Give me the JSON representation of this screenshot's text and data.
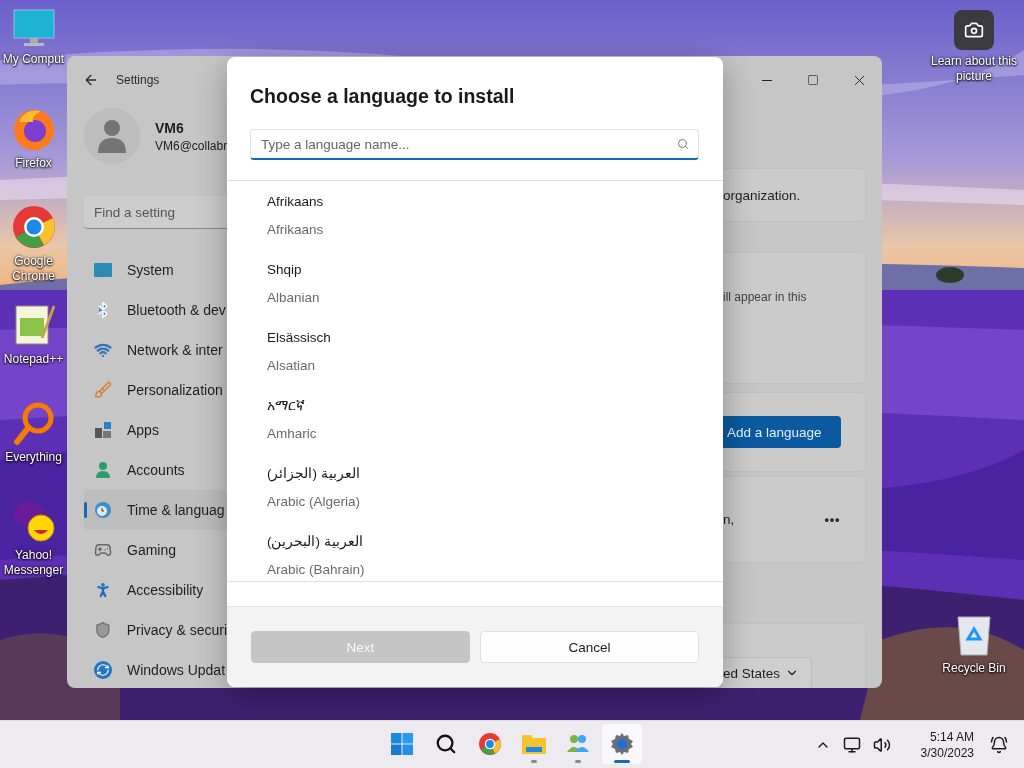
{
  "desktop": {
    "left_icons": [
      {
        "kind": "computer",
        "label": "My Comput"
      },
      {
        "kind": "firefox",
        "label": "Firefox"
      },
      {
        "kind": "chrome",
        "label": "Google Chrome"
      },
      {
        "kind": "notepad",
        "label": "Notepad++"
      },
      {
        "kind": "everything",
        "label": "Everything"
      },
      {
        "kind": "yahoo",
        "label": "Yahoo! Messenger"
      }
    ],
    "right_icons": [
      {
        "kind": "camera",
        "label": "Learn about this picture"
      },
      {
        "kind": "recycle",
        "label": "Recycle Bin"
      }
    ]
  },
  "settings_window": {
    "title": "Settings",
    "user": {
      "name": "VM6",
      "email": "VM6@collabr"
    },
    "search": {
      "placeholder": "Find a setting"
    },
    "nav": [
      {
        "kind": "system",
        "label": "System",
        "selected": false
      },
      {
        "kind": "bluetooth",
        "label": "Bluetooth & dev",
        "selected": false
      },
      {
        "kind": "network",
        "label": "Network & inter",
        "selected": false
      },
      {
        "kind": "personalization",
        "label": "Personalization",
        "selected": false
      },
      {
        "kind": "apps",
        "label": "Apps",
        "selected": false
      },
      {
        "kind": "accounts",
        "label": "Accounts",
        "selected": false
      },
      {
        "kind": "time",
        "label": "Time & languag",
        "selected": true
      },
      {
        "kind": "gaming",
        "label": "Gaming",
        "selected": false
      },
      {
        "kind": "accessibility",
        "label": "Accessibility",
        "selected": false
      },
      {
        "kind": "privacy",
        "label": "Privacy & securi",
        "selected": false
      },
      {
        "kind": "update",
        "label": "Windows Updat",
        "selected": false
      }
    ],
    "cards": [
      {
        "kind": "text",
        "text": "organization."
      },
      {
        "kind": "tall",
        "text": "ill appear in this"
      },
      {
        "kind": "button",
        "text": "Add a language"
      },
      {
        "kind": "more",
        "text": "n,"
      },
      {
        "kind": "dropdown",
        "text": "ed States"
      }
    ]
  },
  "dialog": {
    "title": "Choose a language to install",
    "search": {
      "placeholder": "Type a language name..."
    },
    "languages": [
      {
        "native": "Afrikaans",
        "english": "Afrikaans"
      },
      {
        "native": "Shqip",
        "english": "Albanian"
      },
      {
        "native": "Elsässisch",
        "english": "Alsatian"
      },
      {
        "native": "አማርኛ",
        "english": "Amharic"
      },
      {
        "native": "العربية (الجزائر)",
        "english": "Arabic (Algeria)"
      },
      {
        "native": "العربية (البحرين)",
        "english": "Arabic (Bahrain)"
      }
    ],
    "buttons": [
      {
        "kind": "primary",
        "label": "Next",
        "disabled": true
      },
      {
        "kind": "secondary",
        "label": "Cancel",
        "disabled": false
      }
    ]
  },
  "taskbar": {
    "apps": [
      {
        "kind": "start",
        "running": false,
        "selected": false
      },
      {
        "kind": "search",
        "running": false,
        "selected": false
      },
      {
        "kind": "chrome",
        "running": false,
        "selected": false
      },
      {
        "kind": "explorer",
        "running": true,
        "selected": false
      },
      {
        "kind": "messenger",
        "running": true,
        "selected": false
      },
      {
        "kind": "settings",
        "running": true,
        "selected": true
      }
    ],
    "time": "5:14 AM",
    "date": "3/30/2023"
  }
}
